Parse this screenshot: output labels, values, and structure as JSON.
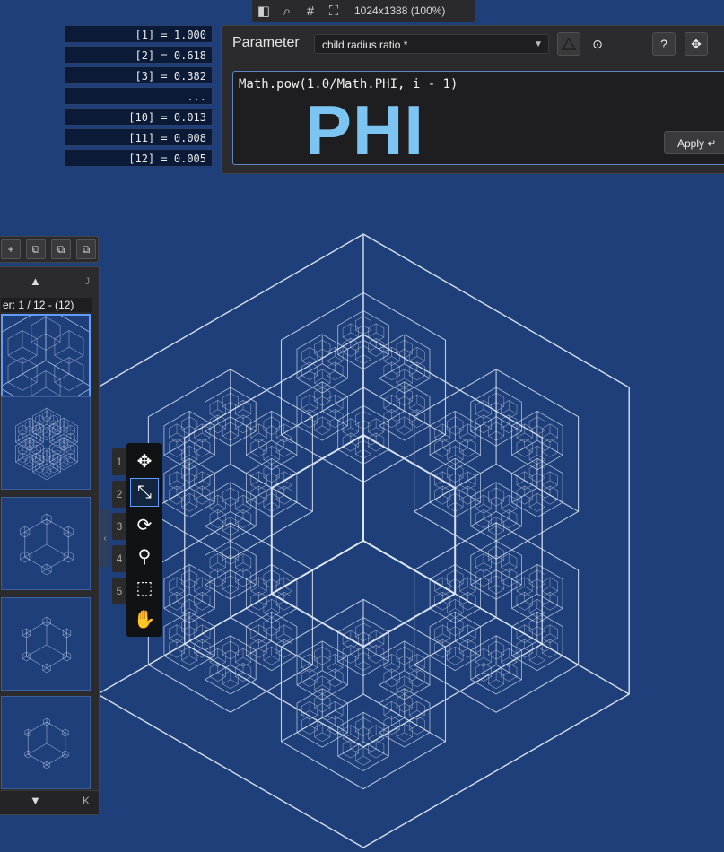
{
  "topbar": {
    "icons": [
      "sidebar-icon",
      "search-icon",
      "grid-icon",
      "fullscreen-icon"
    ],
    "dimensions": "1024x1388 (100%)"
  },
  "values": [
    "[1] = 1.000",
    "[2] = 0.618",
    "[3] = 0.382",
    "...",
    "[10] = 0.013",
    "[11] = 0.008",
    "[12] = 0.005"
  ],
  "parameter": {
    "title": "Parameter",
    "selected": "child radius ratio *",
    "expression": "Math.pow(1.0/Math.PHI, i - 1)",
    "overlay": "PHI",
    "apply_label": "Apply ↵",
    "help_label": "?"
  },
  "layer": {
    "label": "er: 1 / 12 - (12)",
    "corner_top": "J",
    "corner_bottom": "K"
  },
  "tools": {
    "numbers": [
      "1",
      "2",
      "3",
      "4",
      "5"
    ],
    "active": "fit-tool"
  },
  "colors": {
    "canvas_bg": "#1f3f7a",
    "line": "#dfe8f7",
    "accent": "#5f9cff",
    "phi_text": "#7cc4f2"
  }
}
